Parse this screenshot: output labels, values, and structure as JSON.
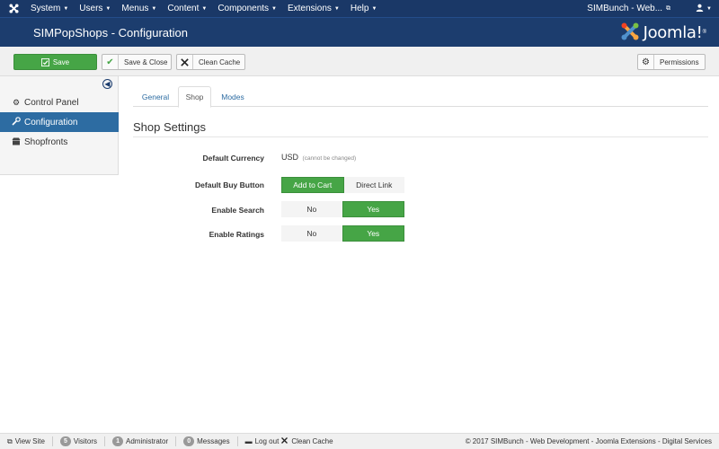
{
  "topnav": {
    "menus": [
      {
        "label": "System"
      },
      {
        "label": "Users"
      },
      {
        "label": "Menus"
      },
      {
        "label": "Content"
      },
      {
        "label": "Components"
      },
      {
        "label": "Extensions"
      },
      {
        "label": "Help"
      }
    ],
    "site_link": "SIMBunch - Web...",
    "user_icon": "user-icon"
  },
  "header": {
    "title": "SIMPopShops - Configuration",
    "brand": "Joomla!",
    "brand_mark": "®"
  },
  "toolbar": {
    "save_label": "Save",
    "save_close_label": "Save & Close",
    "clean_cache_label": "Clean Cache",
    "permissions_label": "Permissions"
  },
  "sidebar": {
    "items": [
      {
        "label": "Control Panel",
        "icon": "cogs-icon",
        "active": false
      },
      {
        "label": "Configuration",
        "icon": "wrench-icon",
        "active": true
      },
      {
        "label": "Shopfronts",
        "icon": "shop-icon",
        "active": false
      }
    ]
  },
  "tabs": [
    {
      "label": "General",
      "active": false
    },
    {
      "label": "Shop",
      "active": true
    },
    {
      "label": "Modes",
      "active": false
    }
  ],
  "section": {
    "title": "Shop Settings"
  },
  "form": {
    "currency": {
      "label": "Default Currency",
      "value": "USD",
      "note": "(cannot be changed)"
    },
    "buy_button": {
      "label": "Default Buy Button",
      "options": [
        "Add to Cart",
        "Direct Link"
      ],
      "selected": "Add to Cart"
    },
    "search": {
      "label": "Enable Search",
      "options": [
        "No",
        "Yes"
      ],
      "selected": "Yes"
    },
    "ratings": {
      "label": "Enable Ratings",
      "options": [
        "No",
        "Yes"
      ],
      "selected": "Yes"
    }
  },
  "statusbar": {
    "view_site": "View Site",
    "visitors_count": "5",
    "visitors_label": "Visitors",
    "admin_count": "1",
    "admin_label": "Administrator",
    "messages_count": "0",
    "messages_label": "Messages",
    "logout_label": "Log out",
    "clean_cache_label": "Clean Cache",
    "copyright": "© 2017 SIMBunch - Web Development - Joomla Extensions - Digital Services"
  },
  "colors": {
    "nav_bg": "#1a3867",
    "header_bg": "#1c3d6e",
    "accent_green": "#46a546",
    "active_blue": "#2d6ca2"
  }
}
